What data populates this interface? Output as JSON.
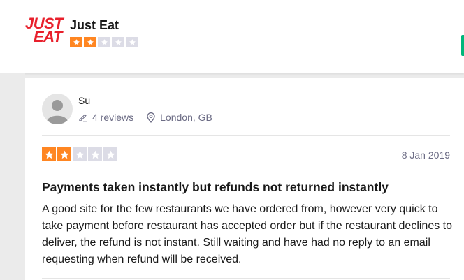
{
  "header": {
    "logo_line1": "JUST",
    "logo_line2": "EAT",
    "company_name": "Just Eat",
    "rating_stars": 2,
    "star_total": 5
  },
  "review": {
    "reviewer": {
      "name": "Su",
      "reviews_count": "4 reviews",
      "location": "London, GB"
    },
    "rating_stars": 2,
    "date": "8 Jan 2019",
    "title": "Payments taken instantly but refunds not returned instantly",
    "body": "A good site for the few restaurants we have ordered from, however very quick to take payment before restaurant has accepted order but if the restaurant declines to deliver, the refund is not instant. Still waiting and have had no reply to an email requesting when refund will be received."
  },
  "colors": {
    "brand": "#e8202c",
    "star_filled": "#ff8622",
    "star_empty": "#dcdce6",
    "accent_green": "#00b67a"
  },
  "icons": {
    "pencil": "pencil-icon",
    "location": "map-pin-icon",
    "avatar": "user-avatar-icon"
  }
}
